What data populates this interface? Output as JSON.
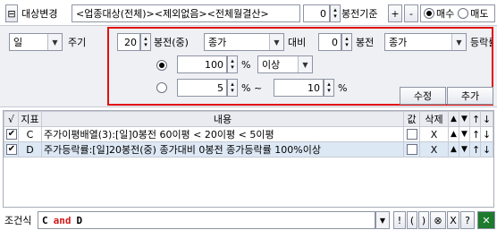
{
  "top": {
    "target_label": "대상변경",
    "target_value": "<업종대상(전체)><제외없음><전체월결산>",
    "offset_value": "0",
    "basis_label": "봉전기준",
    "plus": "+",
    "minus": "-",
    "buy_label": "매수",
    "sell_label": "매도"
  },
  "condition": {
    "period_value": "일",
    "period_label": "주기",
    "row1": {
      "bars_value": "20",
      "bars_label": "봉전(중)",
      "price_value": "종가",
      "vs_label": "대비",
      "bars2_value": "0",
      "bars2_label": "봉전",
      "price2_value": "종가",
      "rate_label": "등락률"
    },
    "row2": {
      "value": "100",
      "unit": "%",
      "compare_value": "이상"
    },
    "row3": {
      "from_value": "5",
      "unit_tilde": "% ~",
      "to_value": "10",
      "unit": "%"
    },
    "modify_label": "수정",
    "add_label": "추가"
  },
  "grid": {
    "headers": [
      "√",
      "지표",
      "내용",
      "값",
      "삭제",
      "▲",
      "▼",
      "↑",
      "↓"
    ],
    "rows": [
      {
        "checked": true,
        "code": "C",
        "content": "주가이평배열(3):[일]0봉전 60이평 < 20이평 < 5이평",
        "del": "X",
        "up": "▲",
        "down": "▼",
        "top": "↑",
        "bottom": "↓"
      },
      {
        "checked": true,
        "code": "D",
        "content": "주가등락률:[일]20봉전(중) 종가대비 0봉전 종가등락률 100%이상",
        "del": "X",
        "up": "▲",
        "down": "▼",
        "top": "↑",
        "bottom": "↓"
      }
    ]
  },
  "bottom": {
    "label": "조건식",
    "expr_a": "C",
    "expr_and": "and",
    "expr_b": "D",
    "ops": [
      "!",
      "(",
      ")",
      "⊗",
      "X",
      "?"
    ]
  },
  "colors": {
    "highlight_border": "#e21010",
    "and_color": "#d01818",
    "grid_selected": "#dde8f5",
    "excel_green": "#1d7a2e"
  }
}
